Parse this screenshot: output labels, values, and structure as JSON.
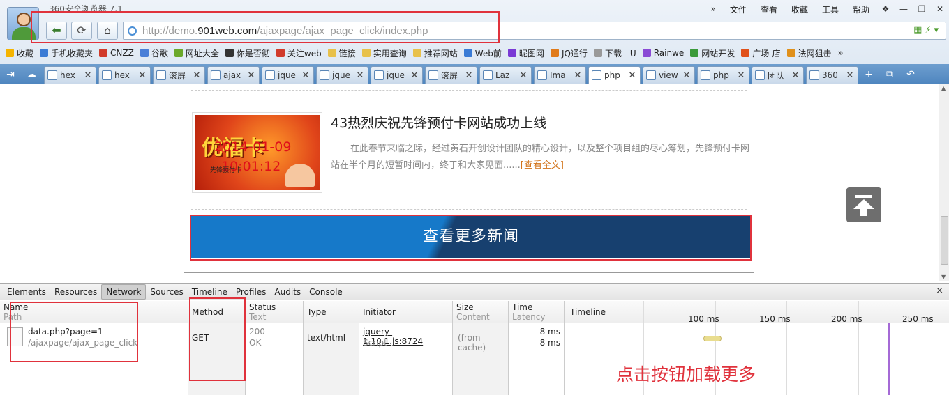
{
  "window": {
    "title": "360安全浏览器 7.1"
  },
  "menu": [
    "文件",
    "查看",
    "收藏",
    "工具",
    "帮助"
  ],
  "menu_chevron": "»",
  "window_controls": [
    "❖",
    "—",
    "❐",
    "✕"
  ],
  "address": {
    "prefix": "http://demo.",
    "domain": "901web.com",
    "path": "/ajaxpage/ajax_page_click/index.php"
  },
  "bookmarks": [
    {
      "label": "收藏",
      "icon": "star-icon",
      "color": "#f5b400"
    },
    {
      "label": "手机收藏夹",
      "icon": "phone-icon",
      "color": "#3a7bd5"
    },
    {
      "label": "CNZZ",
      "icon": "chart-icon",
      "color": "#d13b2b"
    },
    {
      "label": "谷歌",
      "icon": "google-icon",
      "color": "#4a7fd8"
    },
    {
      "label": "网址大全",
      "icon": "globe-icon",
      "color": "#6aa82a"
    },
    {
      "label": "你是否彻",
      "icon": "m-icon",
      "color": "#333333"
    },
    {
      "label": "关注web",
      "icon": "weibo-icon",
      "color": "#d13b2b"
    },
    {
      "label": "链接",
      "icon": "folder-icon",
      "color": "#e8c14a"
    },
    {
      "label": "实用查询",
      "icon": "folder-icon",
      "color": "#e8c14a"
    },
    {
      "label": "推荐网站",
      "icon": "folder-icon",
      "color": "#e8c14a"
    },
    {
      "label": "Web前",
      "icon": "page-icon",
      "color": "#3a7bd5"
    },
    {
      "label": "昵图网",
      "icon": "nipic-icon",
      "color": "#7a3ad5"
    },
    {
      "label": "JQ通行",
      "icon": "jq-icon",
      "color": "#e07a1a"
    },
    {
      "label": "下载 - U",
      "icon": "page-icon",
      "color": "#999999"
    },
    {
      "label": "Rainwe",
      "icon": "rain-icon",
      "color": "#8a4ad5"
    },
    {
      "label": "网站开发",
      "icon": "grid-icon",
      "color": "#3a9a3a"
    },
    {
      "label": "广场-店",
      "icon": "shop-icon",
      "color": "#e0501a"
    },
    {
      "label": "法网狙击",
      "icon": "smile-icon",
      "color": "#e0901a"
    }
  ],
  "bookmarks_more": "»",
  "tabs": [
    {
      "label": "hex",
      "active": false
    },
    {
      "label": "hex",
      "active": false
    },
    {
      "label": "滚屏",
      "active": false
    },
    {
      "label": "ajax",
      "active": false
    },
    {
      "label": "jque",
      "active": false
    },
    {
      "label": "jque",
      "active": false
    },
    {
      "label": "jque",
      "active": false
    },
    {
      "label": "滚屏",
      "active": false
    },
    {
      "label": "Laz",
      "active": false
    },
    {
      "label": "Ima",
      "active": false
    },
    {
      "label": "php",
      "active": true
    },
    {
      "label": "view",
      "active": false
    },
    {
      "label": "php",
      "active": false
    },
    {
      "label": "团队",
      "active": false
    },
    {
      "label": "360",
      "active": false
    }
  ],
  "news": {
    "title": "43热烈庆祝先锋预付卡网站成功上线",
    "body": "在此春节来临之际，经过黄石开创设计团队的精心设计，以及整个项目组的尽心筹划，先锋预付卡网站在半个月的短暂时间内，终于和大家见面......",
    "more": "[查看全文]",
    "thumb_brand": "优福卡",
    "thumb_date": "2014-01-09",
    "thumb_time": "10:01:12",
    "thumb_small": "先锋预付卡"
  },
  "load_more_button": "查看更多新闻",
  "devtools": {
    "tabs": [
      "Elements",
      "Resources",
      "Network",
      "Sources",
      "Timeline",
      "Profiles",
      "Audits",
      "Console"
    ],
    "active_tab": "Network",
    "close": "×",
    "columns": {
      "name": {
        "h1": "Name",
        "h2": "Path"
      },
      "method": "Method",
      "status": {
        "h1": "Status",
        "h2": "Text"
      },
      "type": "Type",
      "initiator": "Initiator",
      "size": {
        "h1": "Size",
        "h2": "Content"
      },
      "time": {
        "h1": "Time",
        "h2": "Latency"
      },
      "timeline": "Timeline"
    },
    "timeline_ticks": [
      "100 ms",
      "150 ms",
      "200 ms",
      "250 ms"
    ],
    "row": {
      "name": "data.php?page=1",
      "path": "/ajaxpage/ajax_page_click",
      "method": "GET",
      "status": "200",
      "status_text": "OK",
      "type": "text/html",
      "initiator": "jquery-1.10.1.js:8724",
      "initiator_type": "Script",
      "size": "(from cache)",
      "time": "8 ms",
      "latency": "8 ms"
    },
    "annotation": "点击按钮加载更多"
  },
  "colors": {
    "highlight_box": "#e0323c",
    "button_blue": "#1679c9",
    "button_dark": "#17406f",
    "read_more": "#d2731a"
  }
}
